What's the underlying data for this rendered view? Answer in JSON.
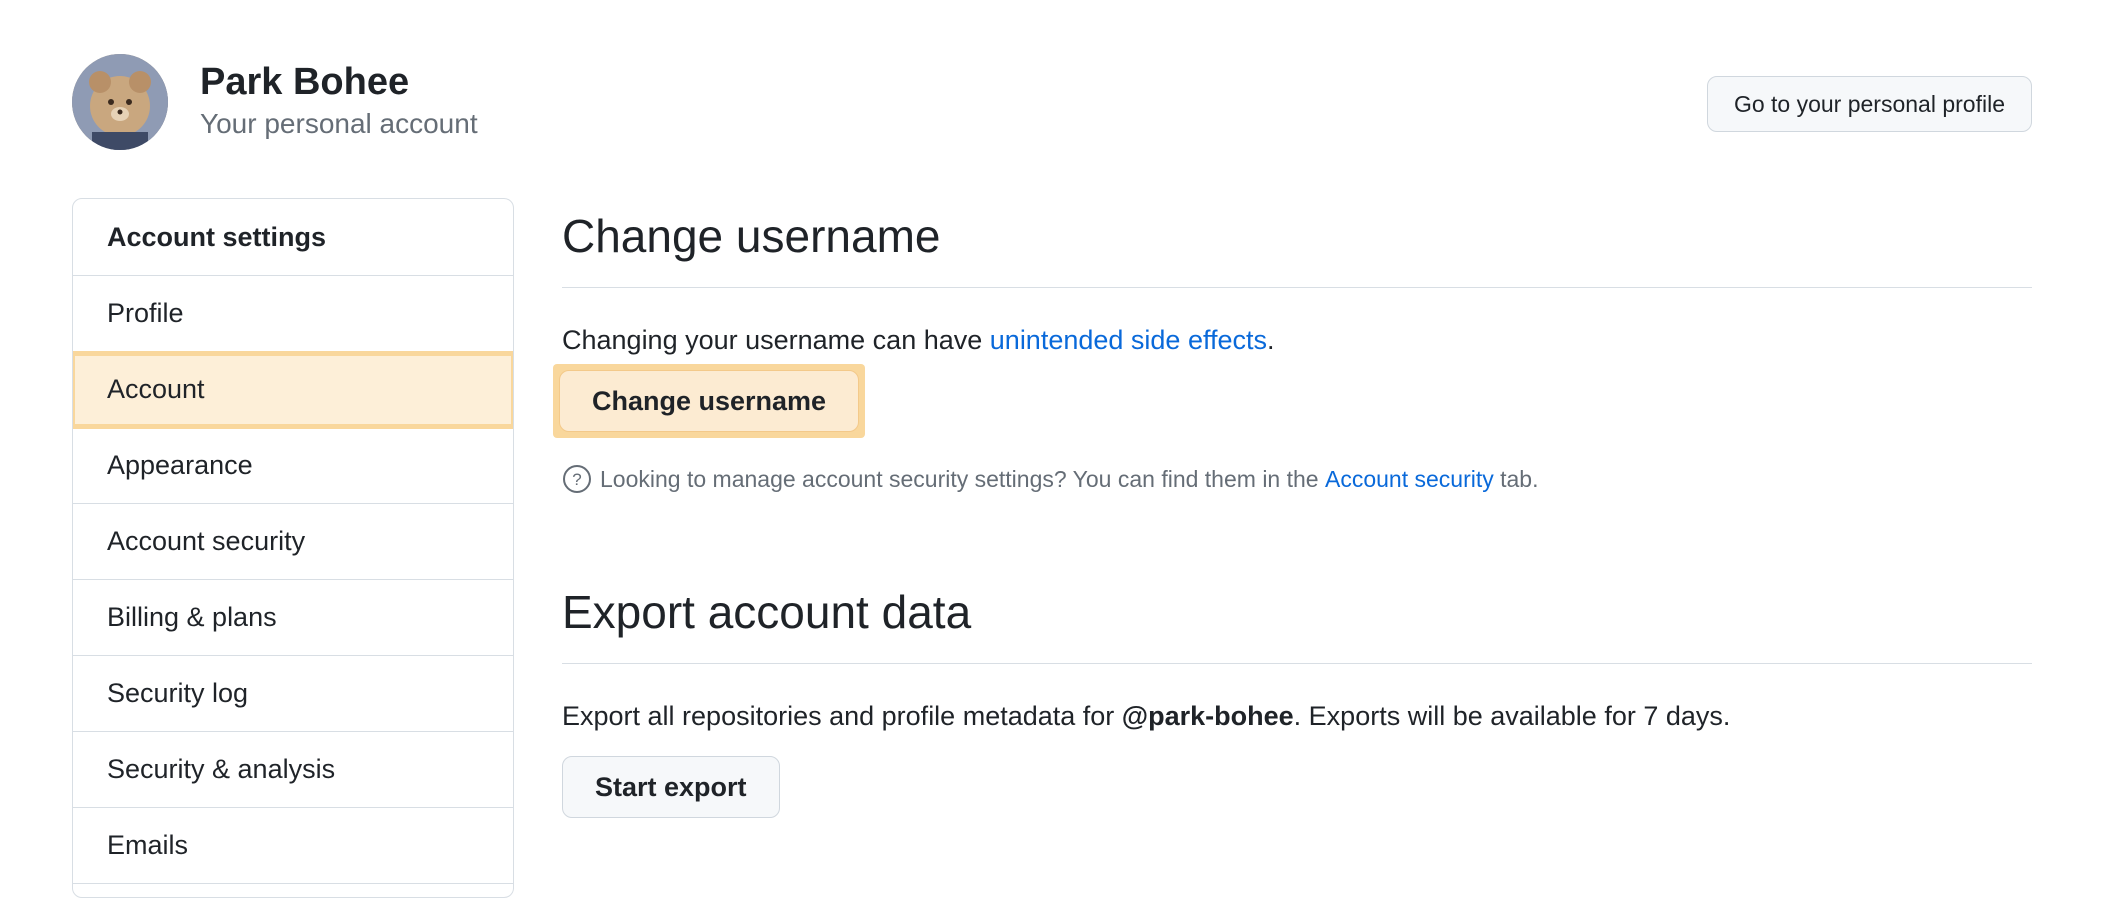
{
  "header": {
    "user_name": "Park Bohee",
    "account_type": "Your personal account",
    "profile_button": "Go to your personal profile",
    "avatar_icon": "avatar-icon"
  },
  "sidebar": {
    "title": "Account settings",
    "items": [
      {
        "label": "Profile",
        "selected": false
      },
      {
        "label": "Account",
        "selected": true
      },
      {
        "label": "Appearance",
        "selected": false
      },
      {
        "label": "Account security",
        "selected": false
      },
      {
        "label": "Billing & plans",
        "selected": false
      },
      {
        "label": "Security log",
        "selected": false
      },
      {
        "label": "Security & analysis",
        "selected": false
      },
      {
        "label": "Emails",
        "selected": false
      }
    ]
  },
  "change_username": {
    "title": "Change username",
    "text_before": "Changing your username can have ",
    "link_text": "unintended side effects",
    "text_after": ".",
    "button": "Change username",
    "note_before": "Looking to manage account security settings? You can find them in the ",
    "note_link": "Account security",
    "note_after": " tab.",
    "note_icon": "question-circle-icon"
  },
  "export_data": {
    "title": "Export account data",
    "text_before": "Export all repositories and profile metadata for ",
    "username": "@park-bohee",
    "text_after": ". Exports will be available for 7 days.",
    "button": "Start export"
  },
  "colors": {
    "link": "#0969da",
    "highlight": "#f9d79c",
    "highlight_fill": "#fdefd8",
    "muted_text": "#656d76"
  }
}
